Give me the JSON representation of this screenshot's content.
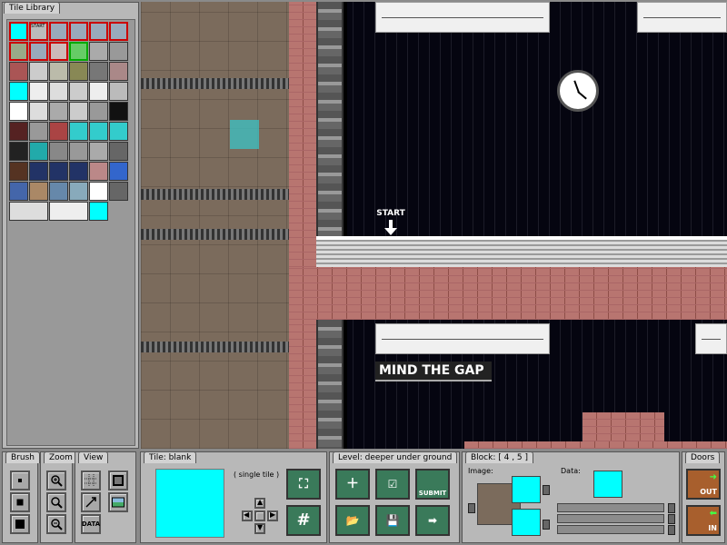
{
  "tile_library": {
    "title": "Tile Library",
    "start_label": "START"
  },
  "map": {
    "start_label": "START",
    "sign_text": "MIND THE GAP"
  },
  "brush": {
    "title": "Brush"
  },
  "zoom": {
    "title": "Zoom"
  },
  "view": {
    "title": "View",
    "data_label": "DATA"
  },
  "tile": {
    "title": "Tile:",
    "name": "blank",
    "mode": "( single tile )",
    "hash_symbol": "#"
  },
  "level": {
    "title": "Level:",
    "name": "deeper under ground",
    "submit_label": "SUBMIT"
  },
  "block": {
    "title": "Block:",
    "coords": "[ 4 , 5 ]",
    "image_label": "Image:",
    "data_label": "Data:"
  },
  "doors": {
    "title": "Doors",
    "out_label": "OUT",
    "in_label": "IN"
  },
  "colors": {
    "cyan": "#00ffff",
    "panel": "#b8b8b8",
    "brick": "#b87570"
  }
}
